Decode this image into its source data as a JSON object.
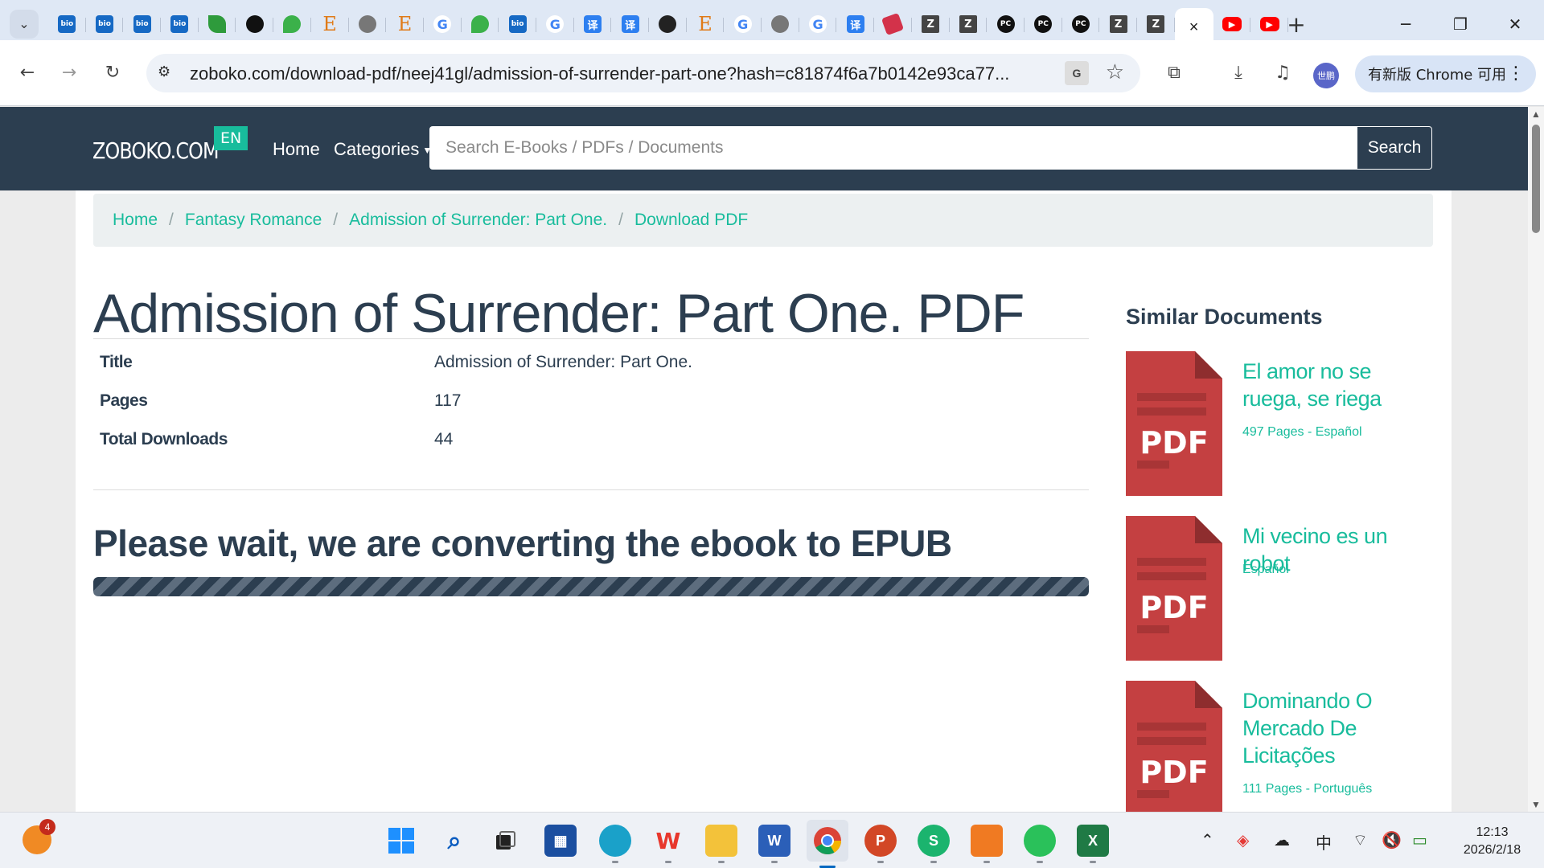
{
  "browser": {
    "tab_close_glyph": "×",
    "new_tab_glyph": "+",
    "url": "zoboko.com/download-pdf/neej41gl/admission-of-surrender-part-one?hash=c81874f6a7b0142e93ca77...",
    "update_label": "有新版 Chrome 可用",
    "profile_label": "世鹏",
    "translate_glyph": "G",
    "tab_favicons": [
      "bio",
      "bio",
      "bio",
      "bio",
      "leaf",
      "github",
      "green",
      "E",
      "globe",
      "E",
      "G",
      "green",
      "bio",
      "G",
      "translate",
      "translate",
      "openai",
      "E",
      "G",
      "globe",
      "G",
      "translate",
      "red",
      "Z",
      "Z",
      "pc",
      "pc",
      "pc",
      "Z",
      "Z"
    ],
    "fav_text": {
      "bio": "bio",
      "E": "E",
      "G": "G",
      "translate": "译",
      "Z": "Z",
      "pc": "PC"
    }
  },
  "site": {
    "brand": "ZOBOKO.COM",
    "lang_badge": "EN",
    "nav": {
      "home": "Home",
      "categories": "Categories"
    },
    "search": {
      "placeholder": "Search E-Books / PDFs / Documents",
      "button": "Search"
    }
  },
  "breadcrumb": [
    "Home",
    "Fantasy Romance",
    "Admission of Surrender: Part One.",
    "Download PDF"
  ],
  "document": {
    "heading": "Admission of Surrender: Part One. PDF",
    "meta": [
      {
        "key": "Title",
        "value": "Admission of Surrender: Part One."
      },
      {
        "key": "Pages",
        "value": "117"
      },
      {
        "key": "Total Downloads",
        "value": "44"
      }
    ],
    "status": "Please wait, we are converting the ebook to EPUB",
    "progress_percent": 100
  },
  "similar": {
    "heading": "Similar Documents",
    "thumb_label": "PDF",
    "items": [
      {
        "title": "El amor no se ruega, se riega",
        "meta": "497 Pages -    Español"
      },
      {
        "title": "Mi vecino es un robot",
        "meta": "Español"
      },
      {
        "title": "Dominando O Mercado De Licitações",
        "meta": "111 Pages -    Português"
      }
    ]
  },
  "taskbar": {
    "notification_count": "4",
    "ime": "中",
    "time": "12:13",
    "date": "2026/2/18"
  },
  "colors": {
    "navbar": "#2c3e50",
    "accent": "#18bc9c",
    "pdf_red": "#c44041"
  }
}
